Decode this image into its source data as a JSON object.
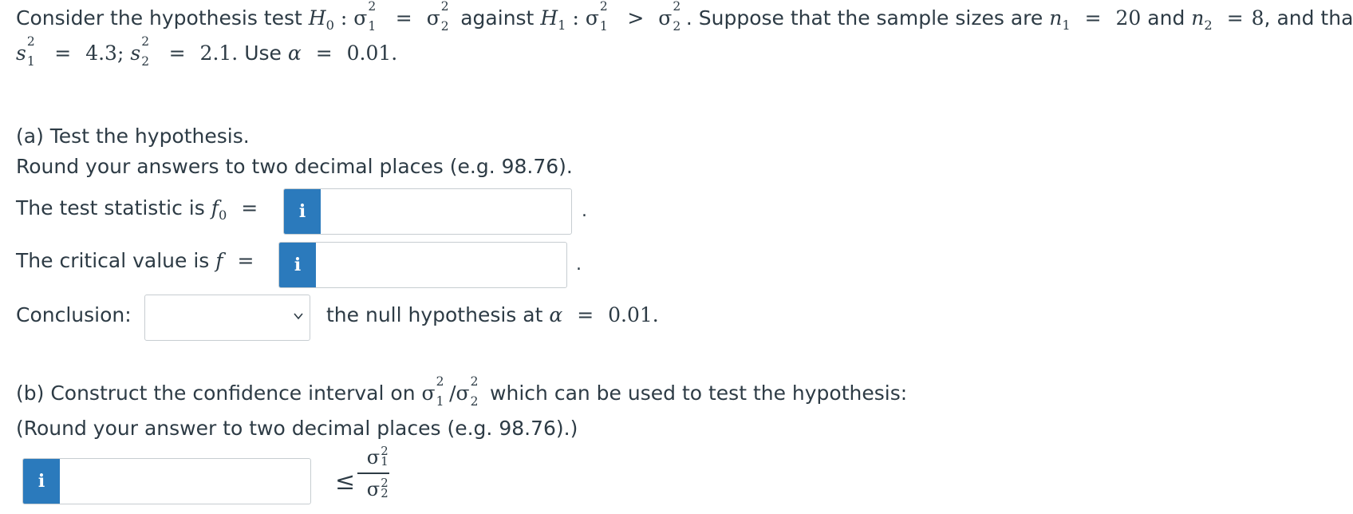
{
  "problem": {
    "intro": "Consider the hypothesis test",
    "h0": "H",
    "h0_sub": "0",
    "colon": ":",
    "sigma": "σ",
    "sub1": "1",
    "sub2": "2",
    "sq": "2",
    "eq": "=",
    "against": "against",
    "h1": "H",
    "h1_sub": "1",
    "gt": ">",
    "suppose": ". Suppose that the sample sizes are",
    "n": "n",
    "n1_val": "20",
    "and": "and",
    "n2_val": "8",
    "and_that": ", and that",
    "s": "s",
    "s1_val": "4.3;",
    "s2_val": "2.1.",
    "use": "Use",
    "alpha": "α",
    "alpha_val": "0.01."
  },
  "part_a": {
    "title": "(a) Test the hypothesis.",
    "round_note": "Round your answers to two decimal places (e.g. 98.76).",
    "test_stat_label": "The test statistic is",
    "f": "f",
    "f0_sub": "0",
    "eq": "=",
    "critical_label": "The critical value is",
    "conclusion_label": "Conclusion:",
    "conclusion_selected": "",
    "conclusion_tail": "the null hypothesis at",
    "alpha": "α",
    "alpha_val": "0.01.",
    "period": "."
  },
  "part_b": {
    "title_start": "(b) Construct the confidence interval on",
    "slash": "/",
    "title_end": "which can be used to test the hypothesis:",
    "round_note": "(Round your answer to two decimal places (e.g. 98.76).)",
    "leq": "≤"
  },
  "inputs": {
    "info_icon_glyph": "i",
    "test_stat_value": "",
    "critical_value": "",
    "ci_lower_value": ""
  },
  "colors": {
    "info_button": "#2b7abc",
    "text": "#2d3b45",
    "border": "#c7cdd1"
  }
}
